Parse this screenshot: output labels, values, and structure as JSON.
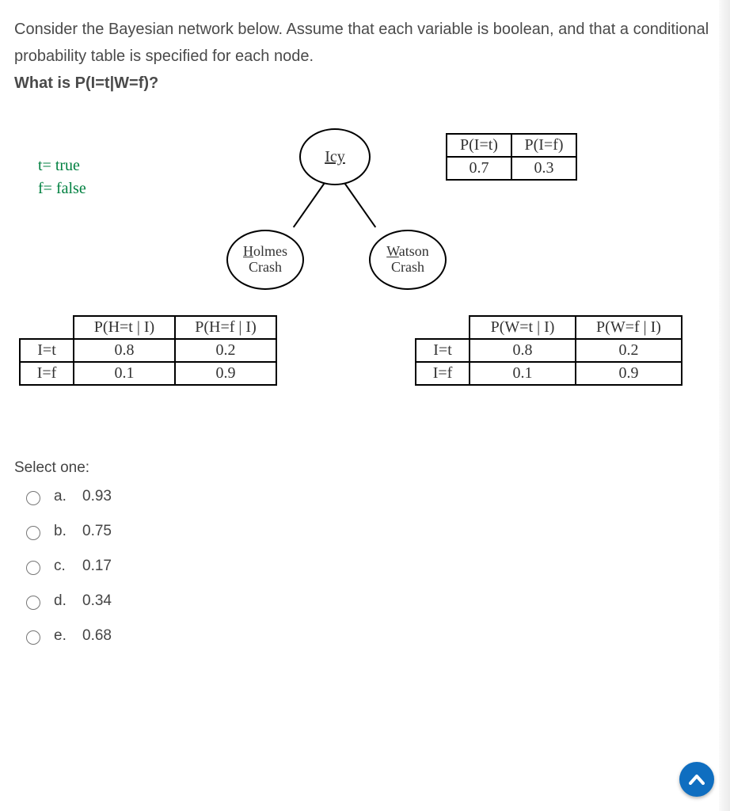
{
  "question": {
    "intro": "Consider the Bayesian network below. Assume that each variable is boolean, and that a conditional probability table is specified for each node.",
    "prompt": "What is P(I=t|W=f)?"
  },
  "legend": {
    "true": "t= true",
    "false": "f= false"
  },
  "nodes": {
    "icy_letter": "I",
    "icy_rest": "cy",
    "hc_line1_letter": "H",
    "hc_line1_rest": "olmes",
    "hc_line2": "Crash",
    "wc_line1_letter": "W",
    "wc_line1_rest": "atson",
    "wc_line2": "Crash"
  },
  "prior_table": {
    "h1": "P(I=t)",
    "h2": "P(I=f)",
    "v1": "0.7",
    "v2": "0.3"
  },
  "cpt_h": {
    "h1": "P(H=t | I)",
    "h2": "P(H=f | I)",
    "r1c0": "I=t",
    "r1c1": "0.8",
    "r1c2": "0.2",
    "r2c0": "I=f",
    "r2c1": "0.1",
    "r2c2": "0.9"
  },
  "cpt_w": {
    "h1": "P(W=t | I)",
    "h2": "P(W=f | I)",
    "r1c0": "I=t",
    "r1c1": "0.8",
    "r1c2": "0.2",
    "r2c0": "I=f",
    "r2c1": "0.1",
    "r2c2": "0.9"
  },
  "answers": {
    "label": "Select one:",
    "opts": [
      {
        "letter": "a.",
        "text": "0.93"
      },
      {
        "letter": "b.",
        "text": "0.75"
      },
      {
        "letter": "c.",
        "text": "0.17"
      },
      {
        "letter": "d.",
        "text": "0.34"
      },
      {
        "letter": "e.",
        "text": "0.68"
      }
    ]
  },
  "chart_data": {
    "type": "table",
    "description": "Bayesian network with root Icy (I) and children Holmes Crash (H), Watson Crash (W)",
    "nodes": [
      "I",
      "H",
      "W"
    ],
    "edges": [
      [
        "I",
        "H"
      ],
      [
        "I",
        "W"
      ]
    ],
    "prior_I": {
      "t": 0.7,
      "f": 0.3
    },
    "P_H_given_I": {
      "I=t": {
        "H=t": 0.8,
        "H=f": 0.2
      },
      "I=f": {
        "H=t": 0.1,
        "H=f": 0.9
      }
    },
    "P_W_given_I": {
      "I=t": {
        "W=t": 0.8,
        "W=f": 0.2
      },
      "I=f": {
        "W=t": 0.1,
        "W=f": 0.9
      }
    },
    "question": "P(I=t | W=f)"
  }
}
